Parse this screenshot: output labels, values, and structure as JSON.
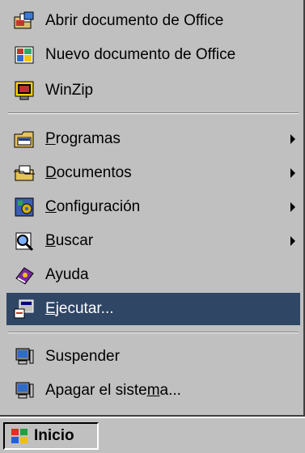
{
  "menu": {
    "items": [
      {
        "label": "Abrir documento de Office",
        "icon": "open-office-document-icon"
      },
      {
        "label": "Nuevo documento de Office",
        "icon": "new-office-document-icon"
      },
      {
        "label": "WinZip",
        "icon": "winzip-icon"
      },
      {
        "label": "Programas",
        "icon": "programs-folder-icon",
        "submenu": true,
        "underline": "P"
      },
      {
        "label": "Documentos",
        "icon": "documents-folder-icon",
        "submenu": true,
        "underline": "D"
      },
      {
        "label": "Configuración",
        "icon": "settings-icon",
        "submenu": true,
        "underline": "C"
      },
      {
        "label": "Buscar",
        "icon": "search-icon",
        "submenu": true,
        "underline": "B"
      },
      {
        "label": "Ayuda",
        "icon": "help-book-icon"
      },
      {
        "label": "Ejecutar...",
        "icon": "run-icon",
        "selected": true,
        "underline": "E"
      },
      {
        "label": "Suspender",
        "icon": "suspend-icon"
      },
      {
        "label": "Apagar el sistema...",
        "icon": "shutdown-icon"
      }
    ]
  },
  "taskbar": {
    "start_label": "Inicio",
    "start_icon": "windows-logo-icon"
  },
  "colors": {
    "menu_bg": "#c0c0c0",
    "selection_bg": "#2f4665",
    "selection_text": "#ffffff"
  }
}
